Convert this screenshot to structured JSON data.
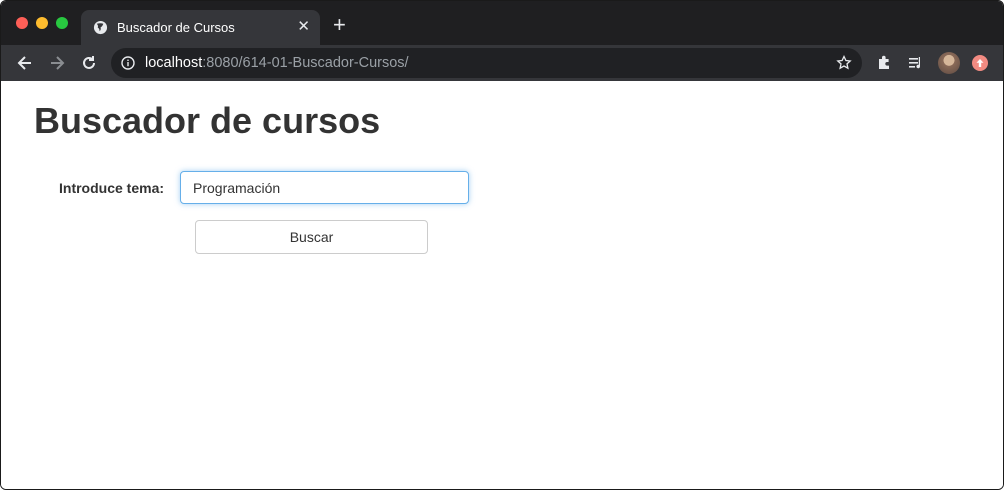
{
  "browser": {
    "tab": {
      "title": "Buscador de Cursos",
      "close_symbol": "✕",
      "favicon": "globe-icon"
    },
    "new_tab_symbol": "+",
    "address": {
      "host": "localhost",
      "rest": ":8080/614-01-Buscador-Cursos/"
    },
    "colors": {
      "frame": "#1f1f21",
      "toolbar": "#35363a",
      "omnibox": "#202124"
    }
  },
  "page": {
    "title": "Buscador de cursos",
    "form": {
      "label": "Introduce tema:",
      "input_value": "Programación",
      "button_label": "Buscar"
    },
    "colors": {
      "text": "#333333",
      "focus": "#66afe9"
    }
  }
}
